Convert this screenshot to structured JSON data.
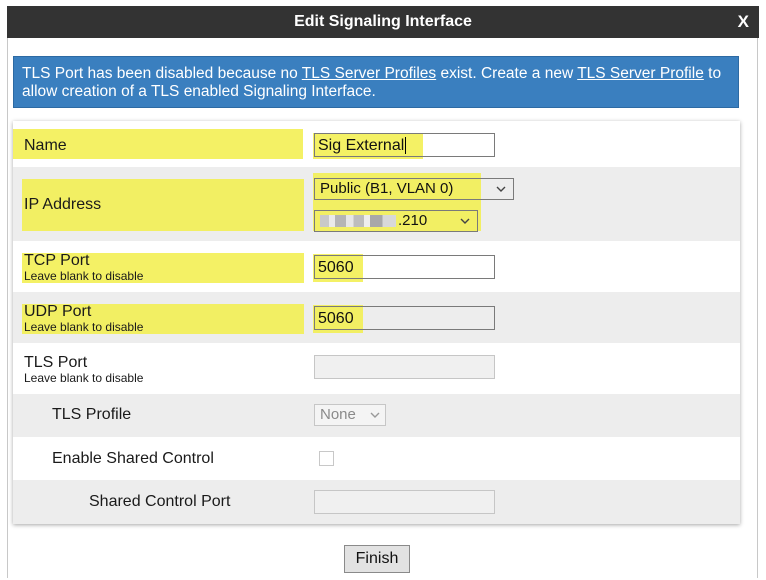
{
  "dialog": {
    "title": "Edit Signaling Interface",
    "close": "X"
  },
  "info": {
    "part1": "TLS Port has been disabled because no ",
    "link1": "TLS Server Profiles",
    "part2": " exist. Create a new ",
    "link2": "TLS Server Profile",
    "part3": " to allow creation of a TLS enabled Signaling Interface."
  },
  "form": {
    "name": {
      "label": "Name",
      "value": "Sig External"
    },
    "ip_address": {
      "label": "IP Address",
      "interface_value": "Public (B1, VLAN 0)",
      "address_suffix": ".210"
    },
    "tcp_port": {
      "label": "TCP Port",
      "hint": "Leave blank to disable",
      "value": "5060"
    },
    "udp_port": {
      "label": "UDP Port",
      "hint": "Leave blank to disable",
      "value": "5060"
    },
    "tls_port": {
      "label": "TLS Port",
      "hint": "Leave blank to disable",
      "value": ""
    },
    "tls_profile": {
      "label": "TLS Profile",
      "value": "None"
    },
    "enable_shared_control": {
      "label": "Enable Shared Control"
    },
    "shared_control_port": {
      "label": "Shared Control Port",
      "value": ""
    }
  },
  "buttons": {
    "finish": "Finish"
  },
  "colors": {
    "titlebar": "#333333",
    "info_bg": "#3a7fbf",
    "highlight": "#f2ee4a",
    "row_shade": "#ededed"
  }
}
